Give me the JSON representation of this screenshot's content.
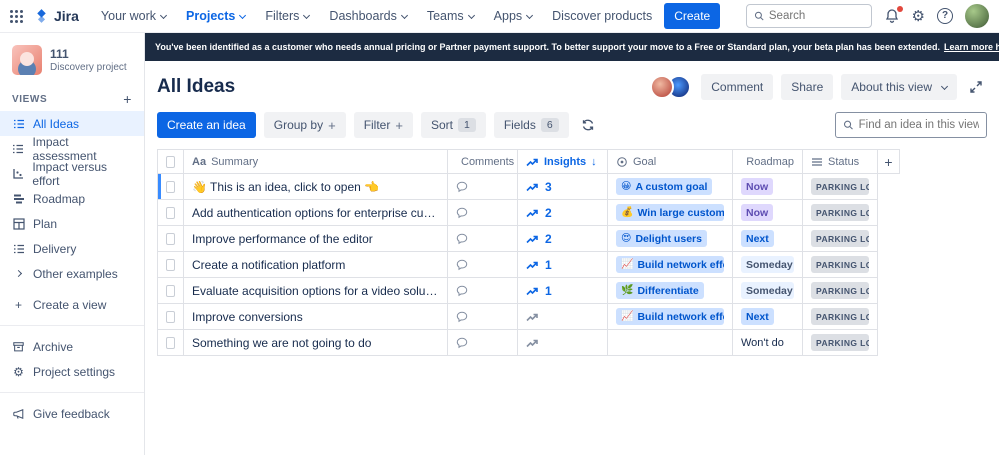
{
  "topbar": {
    "logo_text": "Jira",
    "nav_items": [
      {
        "label": "Your work"
      },
      {
        "label": "Projects"
      },
      {
        "label": "Filters"
      },
      {
        "label": "Dashboards"
      },
      {
        "label": "Teams"
      },
      {
        "label": "Apps"
      },
      {
        "label": "Discover products"
      }
    ],
    "create_button": "Create",
    "search_placeholder": "Search"
  },
  "banner": {
    "message": "You've been identified as a customer who needs annual pricing or Partner payment support. To better support your move to a Free or Standard plan, your beta plan has been extended.",
    "link_label": "Learn more here"
  },
  "sidebar": {
    "project_name": "111",
    "project_type": "Discovery project",
    "views_label": "VIEWS",
    "views": [
      {
        "label": "All Ideas"
      },
      {
        "label": "Impact assessment"
      },
      {
        "label": "Impact versus effort"
      },
      {
        "label": "Roadmap"
      },
      {
        "label": "Plan"
      },
      {
        "label": "Delivery"
      },
      {
        "label": "Other examples"
      }
    ],
    "create_view_label": "Create a view",
    "archive_label": "Archive",
    "settings_label": "Project settings",
    "feedback_label": "Give feedback"
  },
  "view": {
    "title": "All Ideas",
    "comment_button": "Comment",
    "share_button": "Share",
    "about_button": "About this view",
    "toolbar": {
      "create_idea": "Create an idea",
      "group_by": "Group by",
      "filter": "Filter",
      "sort": "Sort",
      "sort_count": "1",
      "fields": "Fields",
      "fields_count": "6",
      "find_placeholder": "Find an idea in this view"
    }
  },
  "table": {
    "columns": {
      "summary_icon": "Aa",
      "summary": "Summary",
      "comments": "Comments",
      "insights": "Insights",
      "insights_sort": "↓",
      "goal": "Goal",
      "roadmap": "Roadmap",
      "status": "Status",
      "add_column": "+"
    },
    "rows": [
      {
        "summary": "👋 This is an idea, click to open 👈",
        "insights": "3",
        "goal_emoji": "😀",
        "goal": "A custom goal",
        "roadmap": "Now",
        "status": "PARKING LOT"
      },
      {
        "summary": "Add authentication options for enterprise customers",
        "insights": "2",
        "goal_emoji": "💰",
        "goal": "Win large customers",
        "roadmap": "Now",
        "status": "PARKING LOT"
      },
      {
        "summary": "Improve performance of the editor",
        "insights": "2",
        "goal_emoji": "😍",
        "goal": "Delight users",
        "roadmap": "Next",
        "status": "PARKING LOT"
      },
      {
        "summary": "Create a notification platform",
        "insights": "1",
        "goal_emoji": "📈",
        "goal": "Build network effects",
        "roadmap": "Someday",
        "status": "PARKING LOT"
      },
      {
        "summary": "Evaluate acquisition options for a video solution",
        "insights": "1",
        "goal_emoji": "🌿",
        "goal": "Differentiate",
        "roadmap": "Someday",
        "status": "PARKING LOT"
      },
      {
        "summary": "Improve conversions",
        "insights": "",
        "goal_emoji": "📈",
        "goal": "Build network effects",
        "roadmap": "Next",
        "status": "PARKING LOT"
      },
      {
        "summary": "Something we are not going to do",
        "insights": "",
        "goal_emoji": "",
        "goal": "",
        "roadmap": "Won't do",
        "status": "PARKING LOT"
      }
    ]
  },
  "colors": {
    "accent_blue": "#0C66E4",
    "banner_bg": "#1C2B41",
    "selected_row_bar": "#388BFF",
    "chip_goal_bg": "#CCE0FF",
    "chip_goal_text": "#0055CC",
    "chip_now_bg": "#DFD8FD",
    "chip_now_text": "#5E4DB2",
    "chip_next_bg": "#CCE0FF",
    "chip_someday_bg": "#E9F2FF",
    "chip_status_bg": "#DCDFE4",
    "notification_dot": "#E2483D"
  }
}
